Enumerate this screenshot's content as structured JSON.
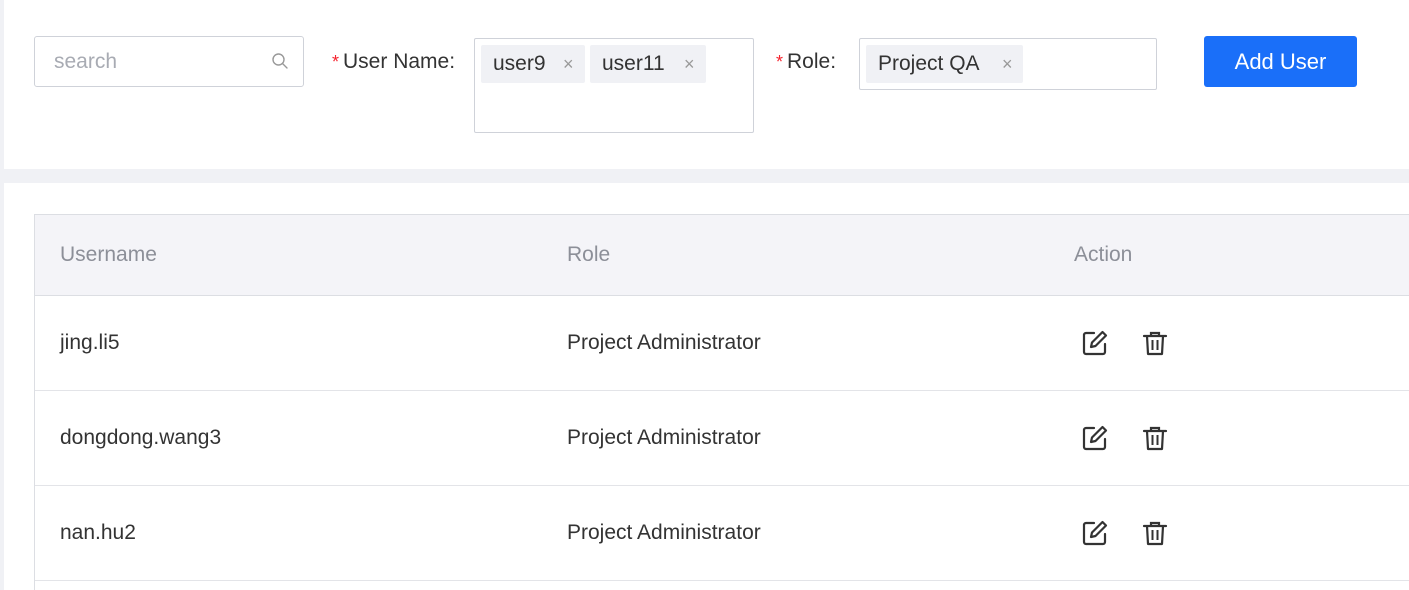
{
  "search": {
    "placeholder": "search",
    "value": ""
  },
  "form": {
    "user_name": {
      "required_mark": "*",
      "label": "User Name:",
      "tags": [
        {
          "label": "user9",
          "close": "×"
        },
        {
          "label": "user11",
          "close": "×"
        }
      ]
    },
    "role": {
      "required_mark": "*",
      "label": "Role:",
      "tags": [
        {
          "label": "Project QA",
          "close": "×"
        }
      ]
    },
    "add_button": "Add User"
  },
  "table": {
    "columns": [
      "Username",
      "Role",
      "Action"
    ],
    "rows": [
      {
        "username": "jing.li5",
        "role": "Project Administrator",
        "actions": [
          "edit-icon",
          "trash-icon"
        ]
      },
      {
        "username": "dongdong.wang3",
        "role": "Project Administrator",
        "actions": [
          "edit-icon",
          "trash-icon"
        ]
      },
      {
        "username": "nan.hu2",
        "role": "Project Administrator",
        "actions": [
          "edit-icon",
          "trash-icon"
        ]
      }
    ]
  },
  "colors": {
    "primary": "#1a6ff9",
    "required": "#f5222d",
    "header_bg": "#f4f4f8",
    "page_bg": "#f0f1f5"
  }
}
